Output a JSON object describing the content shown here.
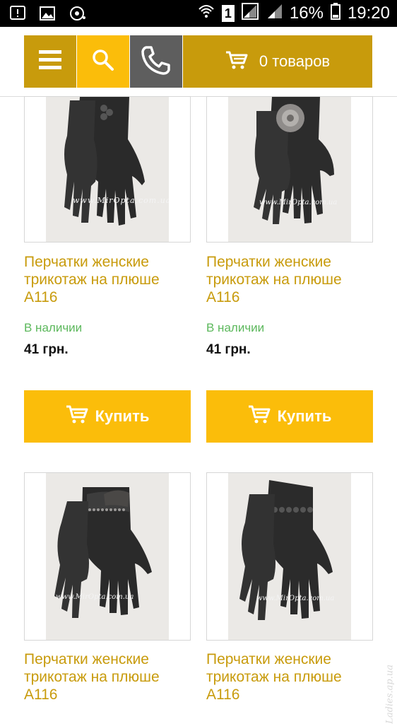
{
  "status_bar": {
    "battery": "16%",
    "time": "19:20",
    "sim": "1"
  },
  "toolbar": {
    "cart_label": "0 товаров"
  },
  "products": [
    {
      "name": "Перчатки женские трикотаж на плюше А116",
      "stock": "В наличии",
      "price": "41 грн.",
      "buy": "Купить",
      "watermark": "www.MirOpta.com.ua"
    },
    {
      "name": "Перчатки женские трикотаж на плюше А116",
      "stock": "В наличии",
      "price": "41 грн.",
      "buy": "Купить",
      "watermark": "www.MirOpta.com.ua"
    },
    {
      "name": "Перчатки женские трикотаж на плюше А116",
      "watermark": "www.MirOpta.com.ua"
    },
    {
      "name": "Перчатки женские трикотаж на плюше А116",
      "watermark": "www.MirOpta.com.ua"
    }
  ],
  "corner_watermark": "Ladies.ap.ua",
  "colors": {
    "accent": "#fbbd0a",
    "accent_dark": "#c89b0c",
    "phone_bg": "#5e5e5e",
    "in_stock": "#5cb85c"
  }
}
